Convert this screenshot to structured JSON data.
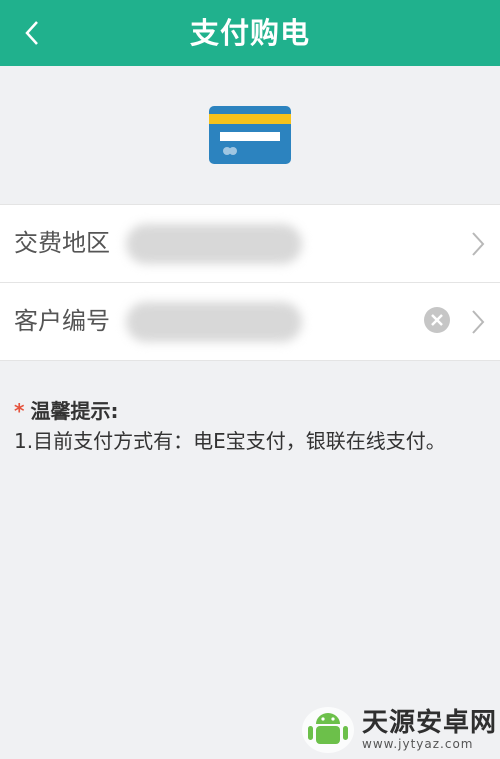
{
  "header": {
    "title": "支付购电",
    "back_icon": "back-arrow-icon"
  },
  "card_icon": "bank-card-icon",
  "colors": {
    "header": "#20b18d",
    "card_blue": "#2c83bf",
    "card_yellow": "#f6c21c",
    "star": "#e5533c"
  },
  "form": {
    "rows": [
      {
        "label": "交费地区",
        "value_redacted": true,
        "actions": [
          "chevron-right-icon"
        ]
      },
      {
        "label": "客户编号",
        "value_redacted": true,
        "actions": [
          "clear-icon",
          "chevron-right-icon"
        ]
      }
    ]
  },
  "tips": {
    "star": "*",
    "title": "温馨提示:",
    "lines": [
      "1.目前支付方式有：电E宝支付，银联在线支付。"
    ]
  },
  "watermark": {
    "name": "天源安卓网",
    "url": "www.jytyaz.com"
  }
}
